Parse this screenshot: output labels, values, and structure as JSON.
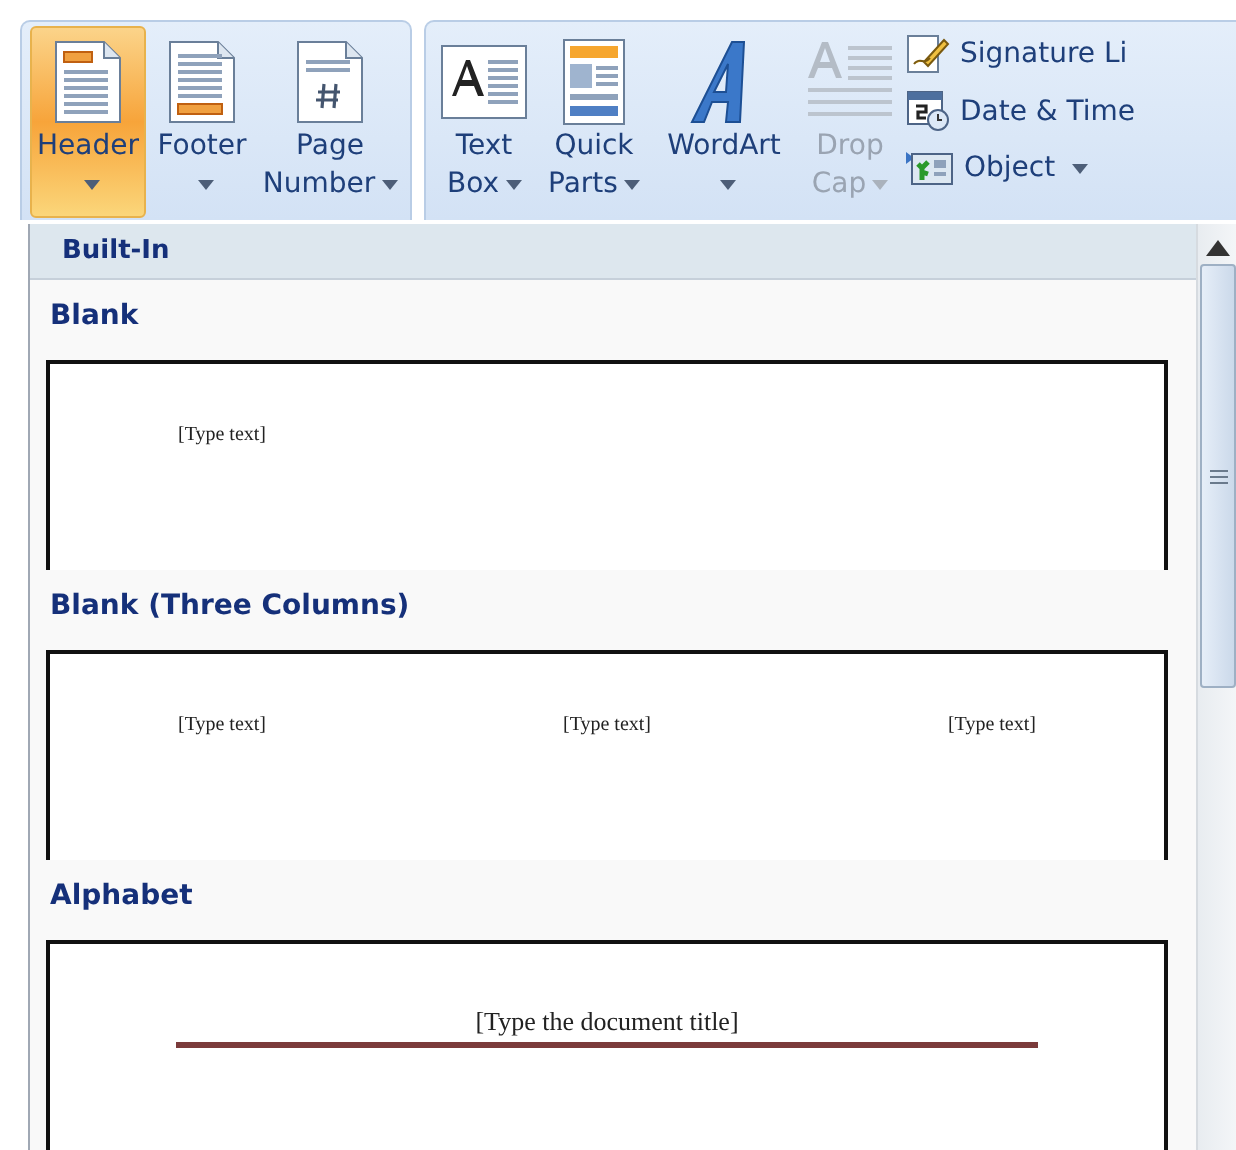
{
  "ribbon": {
    "groups": [
      {
        "buttons": [
          {
            "label": "Header",
            "kind": "header",
            "selected": true,
            "disabled": false,
            "dropdown": true
          },
          {
            "label": "Footer",
            "kind": "footer",
            "selected": false,
            "disabled": false,
            "dropdown": true
          },
          {
            "label": "Page Number",
            "kind": "page-number",
            "selected": false,
            "disabled": false,
            "dropdown": true
          }
        ]
      },
      {
        "buttons": [
          {
            "label": "Text Box",
            "kind": "text-box",
            "selected": false,
            "disabled": false,
            "dropdown": true
          },
          {
            "label": "Quick Parts",
            "kind": "quick-parts",
            "selected": false,
            "disabled": false,
            "dropdown": true
          },
          {
            "label": "WordArt",
            "kind": "wordart",
            "selected": false,
            "disabled": false,
            "dropdown": true
          },
          {
            "label": "Drop Cap",
            "kind": "drop-cap",
            "selected": false,
            "disabled": true,
            "dropdown": true
          }
        ],
        "small_buttons": [
          {
            "label": "Signature Li",
            "kind": "signature",
            "dropdown": false
          },
          {
            "label": "Date & Time",
            "kind": "calendar",
            "dropdown": false
          },
          {
            "label": "Object",
            "kind": "object",
            "dropdown": true
          }
        ]
      }
    ]
  },
  "gallery": {
    "category": "Built-In",
    "items": [
      {
        "name": "Blank",
        "kind": "single",
        "placeholders": [
          "[Type text]"
        ]
      },
      {
        "name": "Blank (Three Columns)",
        "kind": "columns",
        "placeholders": [
          "[Type text]",
          "[Type text]",
          "[Type text]"
        ]
      },
      {
        "name": "Alphabet",
        "kind": "title",
        "placeholders": [
          "[Type the document title]"
        ]
      }
    ]
  }
}
